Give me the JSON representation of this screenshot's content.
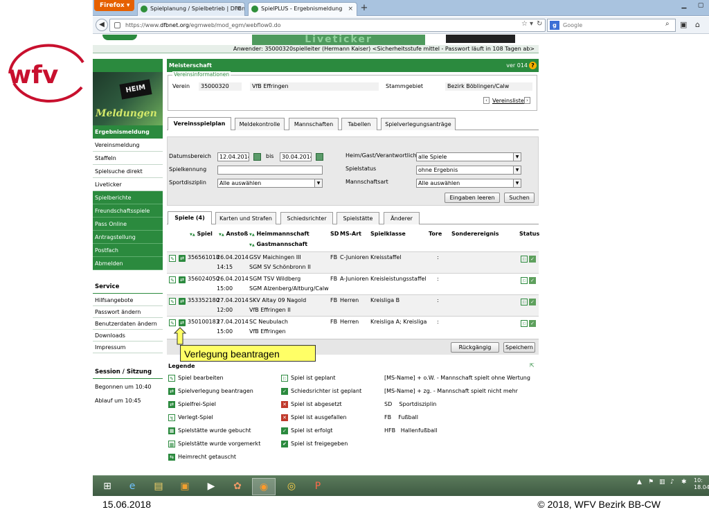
{
  "browser": {
    "firefox_label": "Firefox",
    "tabs": [
      {
        "label": "Spielplanung / Spielbetrieb | DFBnet"
      },
      {
        "label": "SpielPLUS - Ergebnismeldung"
      }
    ],
    "url_prefix": "https://www.",
    "url_domain": "dfbnet.org",
    "url_path": "/egmweb/mod_egm/webflow0.do",
    "search_placeholder": "Google"
  },
  "app": {
    "anwender": "Anwender: 35000320spielleiter (Hermann Kaiser) <Sicherheitsstufe mittel - Passwort läuft in 108 Tagen ab>",
    "banner_text": "Liveticker",
    "meister_title": "Meisterschaft",
    "version": "ver 014",
    "help": "?"
  },
  "sidebar": {
    "meldungen_text": "Meldungen",
    "heim_text": "HEIM",
    "items": [
      {
        "label": "Ergebnismeldung",
        "style": "head"
      },
      {
        "label": "Vereinsmeldung",
        "style": "white"
      },
      {
        "label": "Staffeln",
        "style": "white"
      },
      {
        "label": "Spielsuche direkt",
        "style": "white"
      },
      {
        "label": "Liveticker",
        "style": "white"
      },
      {
        "label": "Spielberichte",
        "style": "green"
      },
      {
        "label": "Freundschaftsspiele",
        "style": "green"
      },
      {
        "label": "Pass Online",
        "style": "green"
      },
      {
        "label": "Antragstellung",
        "style": "green"
      },
      {
        "label": "Postfach",
        "style": "green"
      },
      {
        "label": "Abmelden",
        "style": "green"
      }
    ],
    "service_title": "Service",
    "service_items": [
      "Hilfsangebote",
      "Passwort ändern",
      "Benutzerdaten ändern",
      "Downloads",
      "Impressum"
    ],
    "session_title": "Session / Sitzung",
    "session_begonnen": "Begonnen um 10:40",
    "session_ablauf": "Ablauf um 10:45"
  },
  "vereinsinfo": {
    "legend": "Vereinsinformationen",
    "verein_label": "Verein",
    "verein_nr": "35000320",
    "verein_name": "VfB Effringen",
    "stammgebiet_label": "Stammgebiet",
    "stammgebiet": "Bezirk Böblingen/Calw",
    "vereinsliste": "Vereinsliste"
  },
  "main_tabs": [
    "Vereinsspielplan",
    "Meldekontrolle",
    "Mannschaften",
    "Tabellen",
    "Spielverlegungsanträge"
  ],
  "filters": {
    "datumsbereich_label": "Datumsbereich",
    "date_from": "12.04.2014",
    "bis_label": "bis",
    "date_to": "30.04.2014",
    "spielkennung_label": "Spielkennung",
    "spielkennung_value": "",
    "sportdisziplin_label": "Sportdisziplin",
    "sportdisziplin_value": "Alle auswählen",
    "heimgast_label": "Heim/Gast/Verantwortlich",
    "heimgast_value": "alle Spiele",
    "spielstatus_label": "Spielstatus",
    "spielstatus_value": "ohne Ergebnis",
    "mannschaftsart_label": "Mannschaftsart",
    "mannschaftsart_value": "Alle auswählen",
    "btn_clear": "Eingaben leeren",
    "btn_search": "Suchen"
  },
  "result_tabs": [
    "Spiele (4)",
    "Karten und Strafen",
    "Schiedsrichter",
    "Spielstätte",
    "Änderer"
  ],
  "table": {
    "headers": {
      "spiel": "Spiel",
      "anstoss": "Anstoß",
      "heim": "Heimmannschaft",
      "gast": "Gastmannschaft",
      "sd": "SD",
      "msart": "MS-Art",
      "spielklasse": "Spielklasse",
      "tore": "Tore",
      "sonder": "Sonderereignis",
      "status": "Status"
    },
    "rows": [
      {
        "spiel": "356561018",
        "datum": "26.04.2014",
        "zeit": "14:15",
        "heim": "GSV Maichingen III",
        "gast": "SGM SV Schönbronn II",
        "sd": "FB",
        "msart": "C-Junioren",
        "klasse": "Kreisstaffel",
        "tore": ":"
      },
      {
        "spiel": "356024050",
        "datum": "26.04.2014",
        "zeit": "15:00",
        "heim": "SGM TSV Wildberg",
        "gast": "SGM Alzenberg/Altburg/Calw",
        "sd": "FB",
        "msart": "A-Junioren",
        "klasse": "Kreisleistungsstaffel",
        "tore": ":"
      },
      {
        "spiel": "353352180",
        "datum": "27.04.2014",
        "zeit": "12:00",
        "heim": "SKV Altay 09 Nagold",
        "gast": "VfB Effringen II",
        "sd": "FB",
        "msart": "Herren",
        "klasse": "Kreisliga B",
        "tore": ":"
      },
      {
        "spiel": "350100183",
        "datum": "27.04.2014",
        "zeit": "15:00",
        "heim": "SC Neubulach",
        "gast": "VfB Effringen",
        "sd": "FB",
        "msart": "Herren",
        "klasse": "Kreisliga A; Kreisliga",
        "tore": ":"
      }
    ],
    "btn_reset": "Rückgängig",
    "btn_save": "Speichern"
  },
  "callout": "Verlegung beantragen",
  "legend": {
    "title": "Legende",
    "col1": [
      "Spiel bearbeiten",
      "Spielverlegung beantragen",
      "Spielfrei-Spiel",
      "Verlegt-Spiel",
      "Spielstätte wurde gebucht",
      "Spielstätte wurde vorgemerkt",
      "Heimrecht getauscht"
    ],
    "col2": [
      "Spiel ist geplant",
      "Schiedsrichter ist geplant",
      "Spiel ist abgesetzt",
      "Spiel ist ausgefallen",
      "Spiel ist erfolgt",
      "Spiel ist freigegeben"
    ],
    "col3": [
      "[MS-Name] + o.W. - Mannschaft spielt ohne Wertung",
      "[MS-Name] + zg. - Mannschaft spielt nicht mehr",
      "SD    Sportdisziplin",
      "FB    Fußball",
      "HFB   Hallenfußball"
    ]
  },
  "taskbar": {
    "clock_time": "10:",
    "clock_date": "18.04"
  },
  "footer": {
    "date": "15.06.2018",
    "copyright": "© 2018, WFV Bezirk BB-CW"
  },
  "colors": {
    "green": "#2b8a3e",
    "wfv_red": "#c8102e",
    "callout_yellow": "#ffff66"
  }
}
